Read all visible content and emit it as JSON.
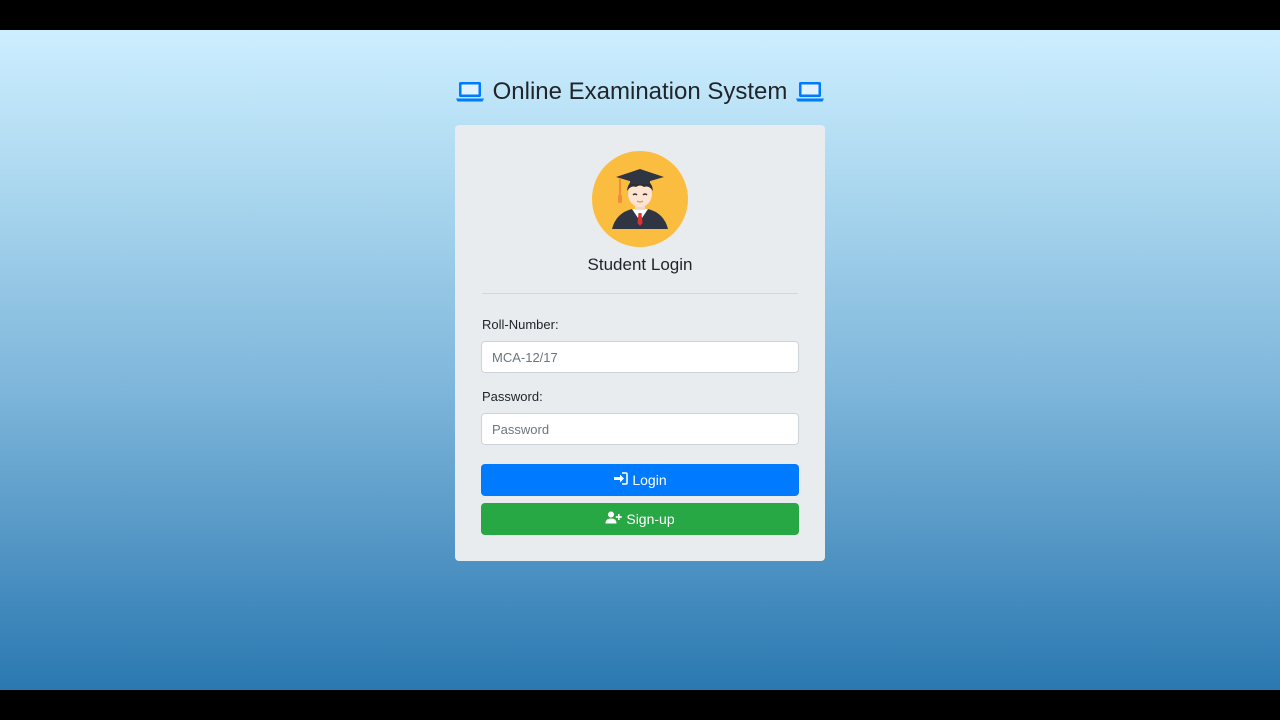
{
  "header": {
    "title": "Online Examination System",
    "left_icon": "laptop-icon",
    "right_icon": "laptop-icon",
    "icon_color": "#007bff"
  },
  "login_card": {
    "avatar_icon": "graduate-avatar-icon",
    "title": "Student Login",
    "roll_number": {
      "label": "Roll-Number:",
      "placeholder": "MCA-12/17",
      "value": ""
    },
    "password": {
      "label": "Password:",
      "placeholder": "Password",
      "value": ""
    },
    "login_button": {
      "label": "Login",
      "icon": "sign-in-icon",
      "color": "#007bff"
    },
    "signup_button": {
      "label": "Sign-up",
      "icon": "user-plus-icon",
      "color": "#28a745"
    }
  }
}
